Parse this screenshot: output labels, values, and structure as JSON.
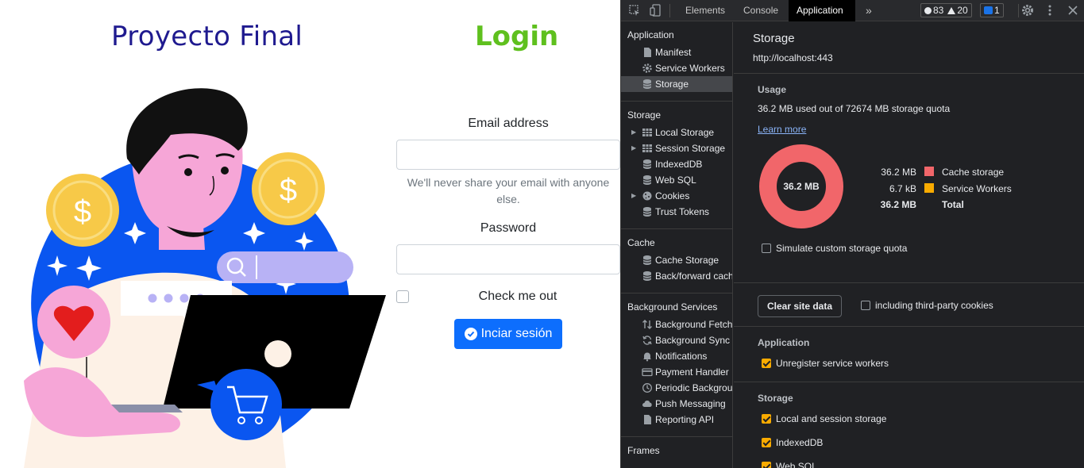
{
  "webpage": {
    "title": "Proyecto Final",
    "login_heading": "Login",
    "email_label": "Email address",
    "email_value": "",
    "email_help": "We'll never share your email with anyone else.",
    "password_label": "Password",
    "password_value": "",
    "remember_label": "Check me out",
    "remember_checked": false,
    "submit_label": "Inciar sesión",
    "colors": {
      "title": "#1f1a8f",
      "login": "#5fc01e",
      "button": "#0d6efd"
    }
  },
  "devtools": {
    "tabs": [
      "Elements",
      "Console",
      "Application"
    ],
    "active_tab": "Application",
    "more_tabs_icon": "chevron-double-right-icon",
    "counters": {
      "errors": "83",
      "warnings": "20",
      "messages": "1"
    },
    "sidebar": {
      "application_heading": "Application",
      "application_items": [
        "Manifest",
        "Service Workers",
        "Storage"
      ],
      "selected": "Storage",
      "storage_heading": "Storage",
      "storage_items": [
        "Local Storage",
        "Session Storage",
        "IndexedDB",
        "Web SQL",
        "Cookies",
        "Trust Tokens"
      ],
      "cache_heading": "Cache",
      "cache_items": [
        "Cache Storage",
        "Back/forward cache"
      ],
      "bg_heading": "Background Services",
      "bg_items": [
        "Background Fetch",
        "Background Sync",
        "Notifications",
        "Payment Handler",
        "Periodic Background Sync",
        "Push Messaging",
        "Reporting API"
      ],
      "frames_heading": "Frames"
    },
    "main": {
      "title": "Storage",
      "origin": "http://localhost:443",
      "usage_heading": "Usage",
      "usage_text": "36.2 MB used out of 72674 MB storage quota",
      "learn_more": "Learn more",
      "donut_label": "36.2 MB",
      "legend": [
        {
          "value": "36.2 MB",
          "label": "Cache storage",
          "color": "#f1666a"
        },
        {
          "value": "6.7 kB",
          "label": "Service Workers",
          "color": "#f9ab00"
        },
        {
          "value": "36.2 MB",
          "label": "Total"
        }
      ],
      "simulate_label": "Simulate custom storage quota",
      "simulate_checked": false,
      "clear_button": "Clear site data",
      "third_party_label": "including third-party cookies",
      "third_party_checked": false,
      "application_heading": "Application",
      "unregister_label": "Unregister service workers",
      "unregister_checked": true,
      "storage_heading": "Storage",
      "local_session_label": "Local and session storage",
      "local_session_checked": true,
      "indexeddb_label": "IndexedDB",
      "indexeddb_checked": true,
      "websql_label": "Web SQL",
      "websql_checked": true
    }
  }
}
